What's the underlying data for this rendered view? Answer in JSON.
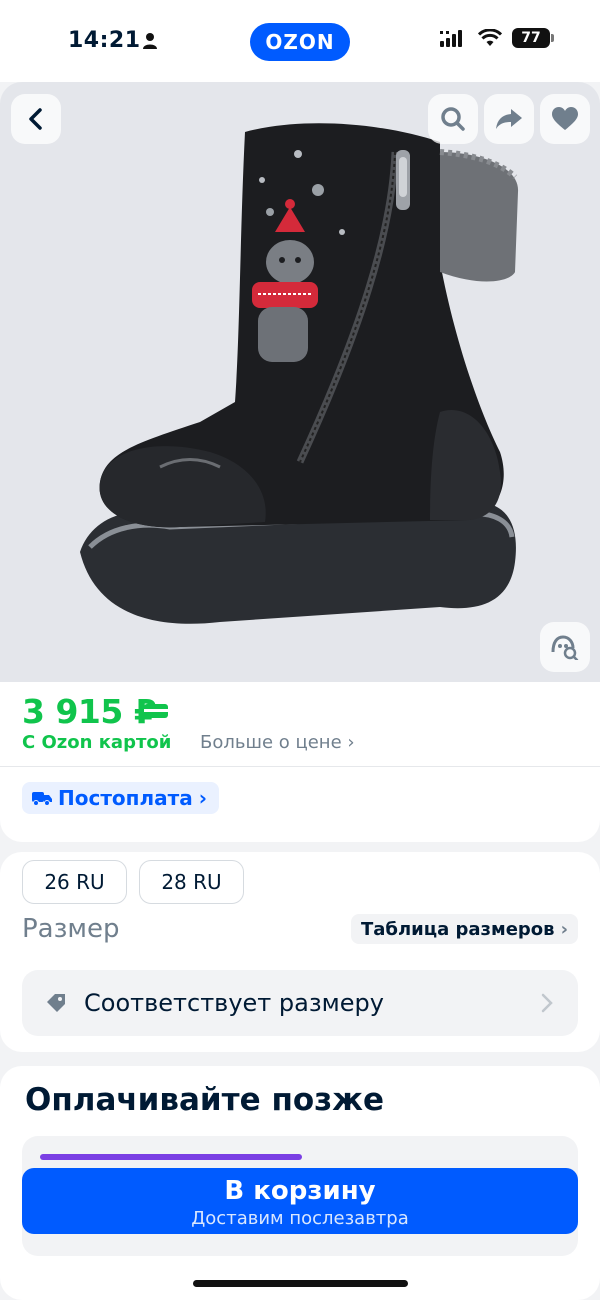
{
  "status_bar": {
    "time": "14:21",
    "logo": "OZON",
    "battery": "77",
    "icons": [
      "person-icon",
      "signal-icon",
      "wifi-icon",
      "battery-icon"
    ]
  },
  "gallery": {
    "icons": [
      "chevron-left-icon",
      "search-icon",
      "share-icon",
      "heart-icon",
      "visual-search-icon"
    ]
  },
  "price": {
    "amount": "3 915 ₽",
    "ozon_card_label": "С Ozon картой",
    "more_link": "Больше о цене ›",
    "postpay_label": "Постоплата",
    "postpay_chevron": "›"
  },
  "sizes": {
    "options": [
      "26 RU",
      "28 RU"
    ],
    "label": "Размер",
    "table_link": "Таблица размеров",
    "table_chevron": "›",
    "fit_text": "Соответствует размеру",
    "fit_chevron": "›"
  },
  "pay_later": {
    "title": "Оплачивайте позже"
  },
  "cart": {
    "title": "В корзину",
    "subtitle": "Доставим послезавтра"
  },
  "colors": {
    "brand": "#005bff",
    "price_green": "#10c44c",
    "text_gray": "#707f8d"
  }
}
